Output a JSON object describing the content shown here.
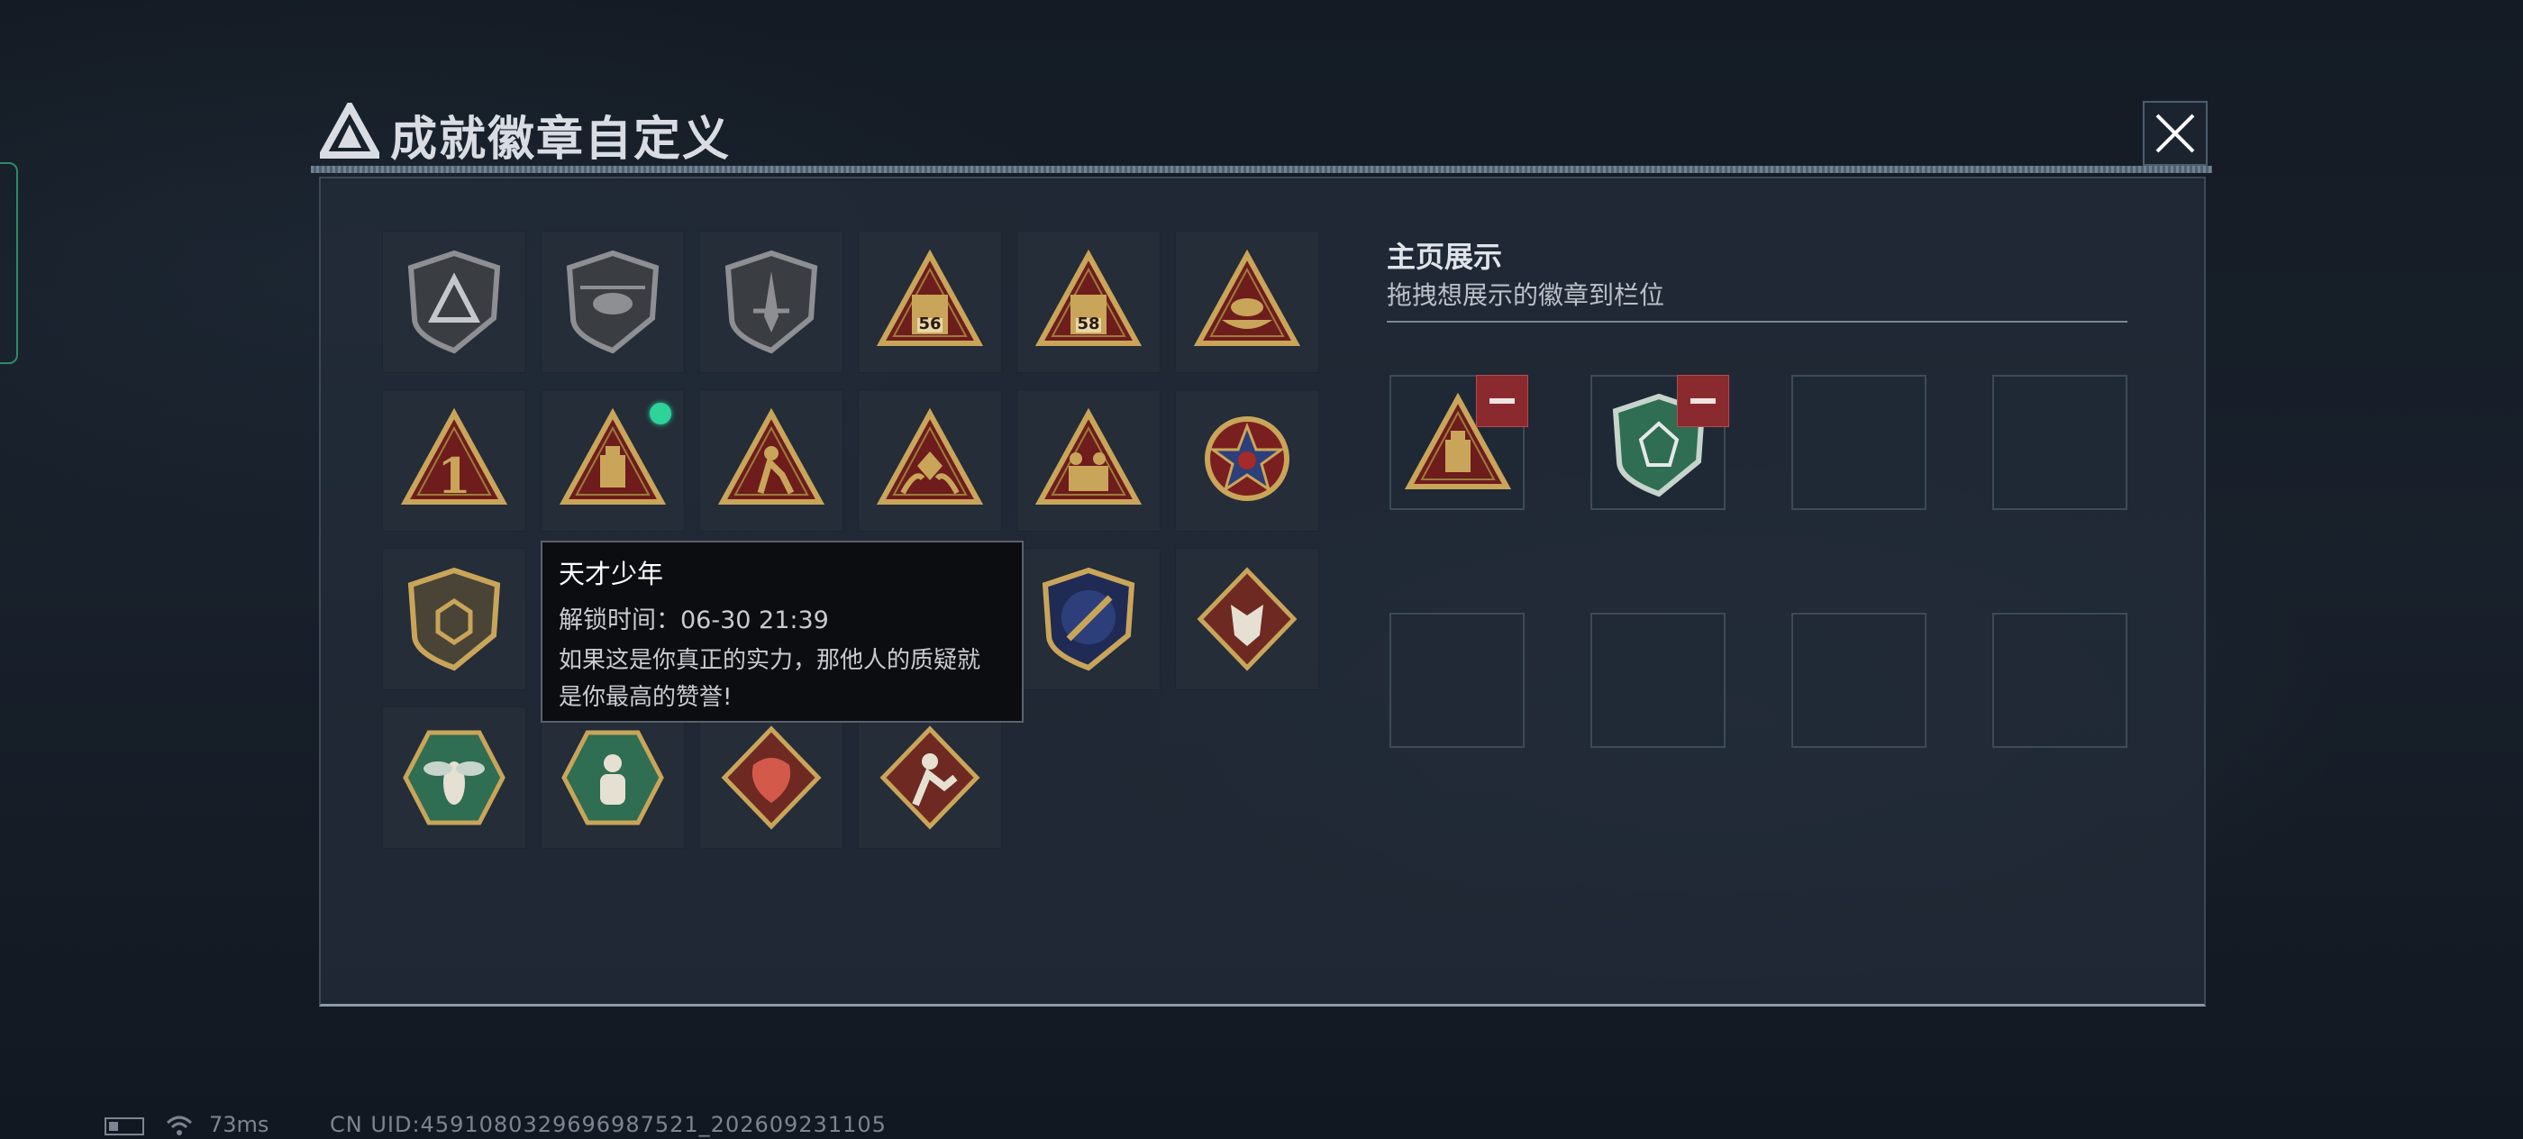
{
  "window": {
    "title": "成就徽章自定义",
    "close_icon": "close-icon"
  },
  "badges": [
    {
      "name": "shield-triangle-emblem-icon",
      "new": false
    },
    {
      "name": "helicopter-shield-icon",
      "new": false
    },
    {
      "name": "dagger-shield-icon",
      "new": false
    },
    {
      "name": "crate-56-triangle-icon",
      "number": "56",
      "new": false
    },
    {
      "name": "crate-58-triangle-icon",
      "number": "58",
      "new": false
    },
    {
      "name": "boat-triangle-icon",
      "new": false
    },
    {
      "name": "number-one-triangle-icon",
      "number": "1",
      "new": false
    },
    {
      "name": "usb-triangle-icon",
      "new": true
    },
    {
      "name": "runner-triangle-icon",
      "new": false
    },
    {
      "name": "hands-gem-triangle-icon",
      "new": false
    },
    {
      "name": "soldiers-triangle-icon",
      "new": false
    },
    {
      "name": "star-medal-icon",
      "new": false
    },
    {
      "name": "hexagon-shield-icon",
      "new": false
    },
    {
      "name": "locked-green-badge-icon",
      "new": true
    },
    {
      "name": "locked-red-badge-icon",
      "new": false
    },
    {
      "name": "crosshair-rifle-shield-icon",
      "new": false
    },
    {
      "name": "rocket-crest-icon",
      "new": false
    },
    {
      "name": "wolf-diamond-icon",
      "new": false
    },
    {
      "name": "wasp-hexagon-icon",
      "new": false
    },
    {
      "name": "figure-hexagon-icon",
      "new": false
    },
    {
      "name": "dragon-diamond-icon",
      "new": false
    },
    {
      "name": "fighter-diamond-icon",
      "new": false
    }
  ],
  "tooltip": {
    "title": "天才少年",
    "unlock": "解锁时间：06-30 21:39",
    "desc_line1": "如果这是你真正的实力，那他人的质疑就",
    "desc_line2": "是你最高的赞誉!"
  },
  "showcase": {
    "title": "主页展示",
    "subtitle": "拖拽想展示的徽章到栏位",
    "slots": [
      {
        "badge": "usb-triangle-icon",
        "filled": true
      },
      {
        "badge": "green-gem-shield-icon",
        "filled": true
      },
      {
        "filled": false
      },
      {
        "filled": false
      },
      {
        "filled": false
      },
      {
        "filled": false
      },
      {
        "filled": false
      },
      {
        "filled": false
      }
    ]
  },
  "status_bar": {
    "ping": "73ms",
    "uid": "CN UID:459108032969698752​1_202609231105"
  },
  "colors": {
    "gold": "#c9a55a",
    "red_triangle": "#7a1f1f",
    "green_badge": "#2f6e52",
    "remove_red": "#8a2a2e",
    "new_dot": "#2ed39a"
  }
}
